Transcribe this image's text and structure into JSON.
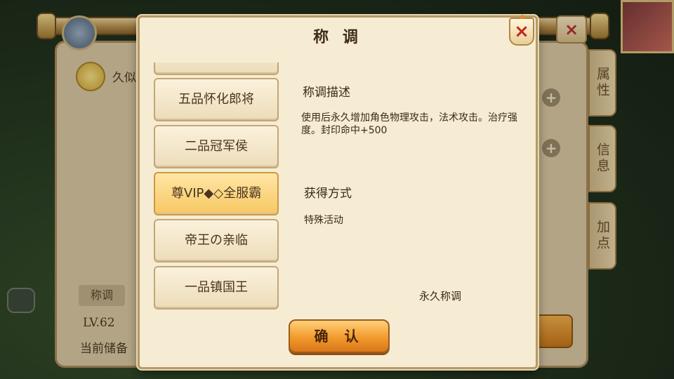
{
  "dialog": {
    "title": "称 调",
    "close_icon": "×",
    "titles_list": [
      {
        "label": "五品怀化郎将",
        "selected": false
      },
      {
        "label": "二品冠军侯",
        "selected": false
      },
      {
        "label": "尊VIP◆◇全服霸",
        "selected": true
      },
      {
        "label": "帝王の亲临",
        "selected": false
      },
      {
        "label": "一品镇国王",
        "selected": false
      }
    ],
    "description_heading": "称调描述",
    "description_text": "使用后永久增加角色物理攻击，法术攻击。治疗强度。封印命中+500",
    "obtain_heading": "获得方式",
    "obtain_text": "特殊活动",
    "duration_text": "永久称调",
    "confirm_label": "确 认"
  },
  "background": {
    "title_chip": "称调",
    "level": "LV.62",
    "storage_label": "当前储备",
    "name_partial": "久似",
    "side_tabs": [
      "属性",
      "信息",
      "加点"
    ],
    "close_icon": "×"
  },
  "colors": {
    "accent": "#f19a2c",
    "selected_item": "#f7c862",
    "close_red": "#c4261f"
  }
}
